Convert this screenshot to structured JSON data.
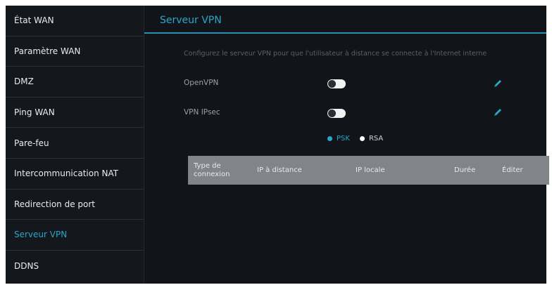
{
  "sidebar": {
    "items": [
      {
        "label": "État WAN",
        "active": false
      },
      {
        "label": "Paramètre WAN",
        "active": false
      },
      {
        "label": "DMZ",
        "active": false
      },
      {
        "label": "Ping WAN",
        "active": false
      },
      {
        "label": "Pare-feu",
        "active": false
      },
      {
        "label": "Intercommunication NAT",
        "active": false
      },
      {
        "label": "Redirection de port",
        "active": false
      },
      {
        "label": "Serveur VPN",
        "active": true
      },
      {
        "label": "DDNS",
        "active": false
      }
    ]
  },
  "main": {
    "title": "Serveur VPN",
    "description": "Configurez le serveur VPN pour que l'utilisateur à distance se connecte à l'Internet interne",
    "openvpn": {
      "label": "OpenVPN",
      "enabled": false,
      "icon": "edit-pencil-icon"
    },
    "ipsec": {
      "label": "VPN IPsec",
      "enabled": false,
      "icon": "edit-pencil-icon"
    },
    "auth": {
      "options": [
        "PSK",
        "RSA"
      ],
      "selected": "PSK"
    },
    "table": {
      "headers": [
        "Type de connexion",
        "IP à distance",
        "IP locale",
        "Durée",
        "Éditer"
      ],
      "rows": []
    }
  },
  "colors": {
    "accent": "#2aa6c9",
    "background": "#111418",
    "table_header": "#818488"
  }
}
